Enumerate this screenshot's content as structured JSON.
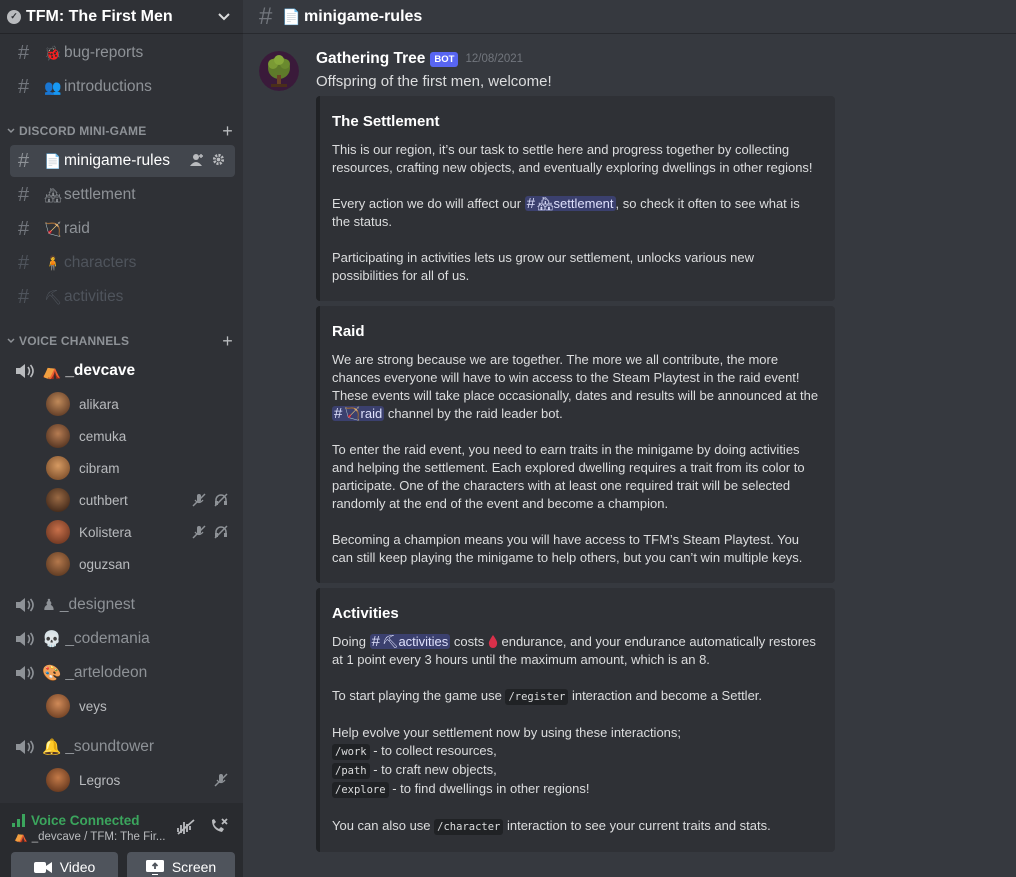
{
  "server": {
    "name": "TFM: The First Men",
    "verified_icon": "✓"
  },
  "sidebar": {
    "channels_top": [
      {
        "name": "bug-reports",
        "emoji": "🐞"
      },
      {
        "name": "introductions",
        "emoji": "👥"
      }
    ],
    "minigame_category": "DISCORD MINI-GAME",
    "minigame_channels": [
      {
        "name": "minigame-rules",
        "emoji": "📄",
        "active": true
      },
      {
        "name": "settlement",
        "emoji": "🏘"
      },
      {
        "name": "raid",
        "emoji": "🏹"
      },
      {
        "name": "characters",
        "emoji": "🧍"
      },
      {
        "name": "activities",
        "emoji": "⛏"
      }
    ],
    "voice_category": "VOICE CHANNELS",
    "voice_channels": [
      {
        "name": "_devcave",
        "emoji": "⛺",
        "users": [
          {
            "name": "alikara"
          },
          {
            "name": "cemuka"
          },
          {
            "name": "cibram"
          },
          {
            "name": "cuthbert",
            "muted": true
          },
          {
            "name": "Kolistera",
            "muted": true
          },
          {
            "name": "oguzsan"
          }
        ]
      },
      {
        "name": "_designest",
        "emoji": "♟"
      },
      {
        "name": "_codemania",
        "emoji": "💀"
      },
      {
        "name": "_artelodeon",
        "emoji": "🎨",
        "users": [
          {
            "name": "veys"
          }
        ]
      },
      {
        "name": "_soundtower",
        "emoji": "🔔",
        "users": [
          {
            "name": "Legros",
            "muted": true
          }
        ]
      }
    ]
  },
  "voice_panel": {
    "status": "Voice Connected",
    "location": "_devcave / TFM: The Fir...",
    "video_label": "Video",
    "screen_label": "Screen"
  },
  "topbar": {
    "channel_name": "minigame-rules",
    "channel_emoji": "📄"
  },
  "message": {
    "author": "Gathering Tree",
    "bot_tag": "BOT",
    "timestamp": "12/08/2021",
    "text": "Offspring of the first men, welcome!"
  },
  "embeds": {
    "settlement": {
      "title": "The Settlement",
      "p1": "This is our region, it’s our task to settle here and progress together by collecting resources, crafting new objects, and eventually exploring dwellings in other regions!",
      "p2_before": "Every action we do will affect our ",
      "p2_mention": "settlement",
      "p2_after": ", so check it often to see what is the status.",
      "p3": "Participating in activities lets us grow our settlement, unlocks various new possibilities for all of us."
    },
    "raid": {
      "title": "Raid",
      "p1_before": "We are strong because we are together. The more we all contribute, the more chances everyone will have to win access to the Steam Playtest in the raid event! These events will take place occasionally, dates and results will be announced at the ",
      "p1_mention": "raid",
      "p1_after": " channel by the raid leader bot.",
      "p2": "To enter the raid event, you need to earn traits in the minigame by doing activities and helping the settlement. Each explored dwelling requires a trait from its color to participate. One of the characters with at least one required trait will be selected randomly at the end of the event and become a champion.",
      "p3": "Becoming a champion means you will have access to TFM’s Steam Playtest. You can still keep playing the minigame to help others, but you can’t win multiple keys."
    },
    "activities": {
      "title": "Activities",
      "p1_before": "Doing ",
      "p1_mention": "activities",
      "p1_mid": " costs ",
      "p1_after": " endurance, and your endurance automatically restores at 1 point every 3 hours until the maximum amount, which is an 8.",
      "p2_before": "To start playing the game use ",
      "p2_code": "/register",
      "p2_after": " interaction and become a Settler.",
      "p3_intro": "Help evolve your settlement now by using these interactions;",
      "cmd1": "/work",
      "cmd1_desc": " - to collect resources,",
      "cmd2": "/path",
      "cmd2_desc": " - to craft new objects,",
      "cmd3": "/explore",
      "cmd3_desc": " - to find dwellings in other regions!",
      "p4_before": "You can also use ",
      "p4_code": "/character",
      "p4_after": " interaction to see your current traits and stats."
    }
  },
  "colors": {
    "accent": "#5865f2",
    "voice_green": "#3ba55d",
    "embed_bg": "#2f3136"
  }
}
